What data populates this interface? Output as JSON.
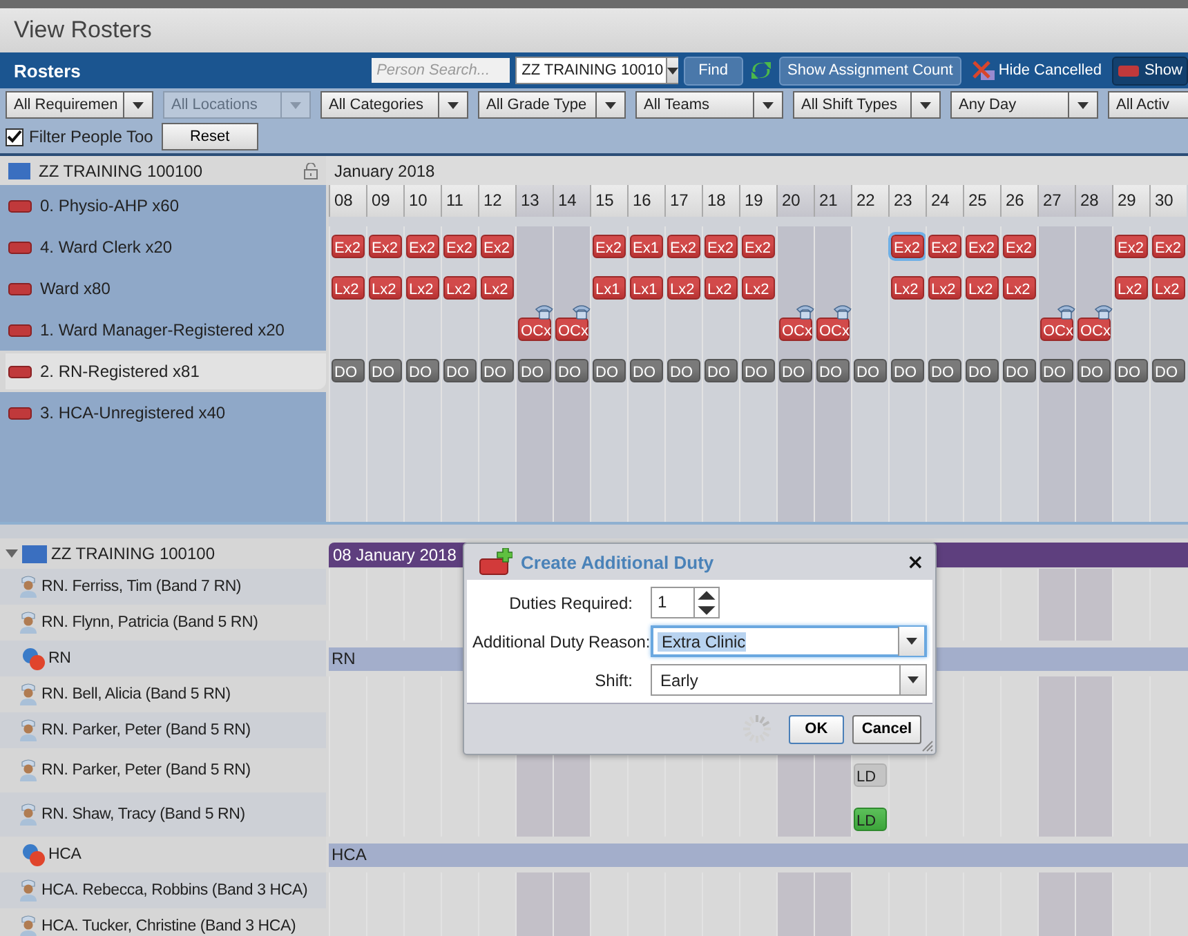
{
  "page_title": "View Rosters",
  "toolbar": {
    "title": "Rosters",
    "search": {
      "placeholder": "Person Search..."
    },
    "roster": {
      "value": "ZZ TRAINING 10010"
    },
    "find": "Find",
    "assignment_count": "Show Assignment Count",
    "hide_cancelled": {
      "label": "Hide Cancelled",
      "pressed": false
    },
    "show": {
      "label": "Show",
      "pressed": true
    }
  },
  "filters": [
    {
      "label": "All Requiremen",
      "disabled": false
    },
    {
      "label": "All Locations",
      "disabled": true
    },
    {
      "label": "All Categories",
      "disabled": false
    },
    {
      "label": "All Grade Type",
      "disabled": false
    },
    {
      "label": "All Teams",
      "disabled": false
    },
    {
      "label": "All Shift Types",
      "disabled": false
    },
    {
      "label": "Any Day",
      "disabled": false
    },
    {
      "label": "All Activ",
      "disabled": false
    }
  ],
  "filter_people_too": {
    "label": "Filter People Too",
    "checked": true
  },
  "reset": "Reset",
  "upper": {
    "roster": "ZZ TRAINING 100100",
    "month": "January 2018",
    "days": [
      {
        "label": "08",
        "weekend": false
      },
      {
        "label": "09",
        "weekend": false
      },
      {
        "label": "10",
        "weekend": false
      },
      {
        "label": "11",
        "weekend": false
      },
      {
        "label": "12",
        "weekend": false
      },
      {
        "label": "13",
        "weekend": true
      },
      {
        "label": "14",
        "weekend": true
      },
      {
        "label": "15",
        "weekend": false
      },
      {
        "label": "16",
        "weekend": false
      },
      {
        "label": "17",
        "weekend": false
      },
      {
        "label": "18",
        "weekend": false
      },
      {
        "label": "19",
        "weekend": false
      },
      {
        "label": "20",
        "weekend": true
      },
      {
        "label": "21",
        "weekend": true
      },
      {
        "label": "22",
        "weekend": false
      },
      {
        "label": "23",
        "weekend": false
      },
      {
        "label": "24",
        "weekend": false
      },
      {
        "label": "25",
        "weekend": false
      },
      {
        "label": "26",
        "weekend": false
      },
      {
        "label": "27",
        "weekend": true
      },
      {
        "label": "28",
        "weekend": true
      },
      {
        "label": "29",
        "weekend": false
      },
      {
        "label": "30",
        "weekend": false
      }
    ],
    "requirements": [
      {
        "label": "0. Physio-AHP x60",
        "selected": false
      },
      {
        "label": "4. Ward Clerk x20",
        "selected": false,
        "cells": [
          {
            "kind": "duty",
            "label": "Ex2",
            "selected": false
          },
          {
            "kind": "duty",
            "label": "Ex2",
            "selected": false
          },
          {
            "kind": "duty",
            "label": "Ex2",
            "selected": false
          },
          {
            "kind": "duty",
            "label": "Ex2",
            "selected": false
          },
          {
            "kind": "duty",
            "label": "Ex2",
            "selected": false
          },
          {
            "kind": "empty"
          },
          {
            "kind": "empty"
          },
          {
            "kind": "duty",
            "label": "Ex2",
            "selected": false
          },
          {
            "kind": "duty",
            "label": "Ex1",
            "selected": false
          },
          {
            "kind": "duty",
            "label": "Ex2",
            "selected": false
          },
          {
            "kind": "duty",
            "label": "Ex2",
            "selected": false
          },
          {
            "kind": "duty",
            "label": "Ex2",
            "selected": false
          },
          {
            "kind": "empty"
          },
          {
            "kind": "empty"
          },
          {
            "kind": "empty"
          },
          {
            "kind": "duty",
            "label": "Ex2",
            "selected": true
          },
          {
            "kind": "duty",
            "label": "Ex2",
            "selected": false
          },
          {
            "kind": "duty",
            "label": "Ex2",
            "selected": false
          },
          {
            "kind": "duty",
            "label": "Ex2",
            "selected": false
          },
          {
            "kind": "empty"
          },
          {
            "kind": "empty"
          },
          {
            "kind": "duty",
            "label": "Ex2",
            "selected": false
          },
          {
            "kind": "duty",
            "label": "Ex2",
            "selected": false
          }
        ]
      },
      {
        "label": "Ward  x80",
        "selected": false,
        "cells": [
          {
            "kind": "duty",
            "label": "Lx2",
            "selected": false
          },
          {
            "kind": "duty",
            "label": "Lx2",
            "selected": false
          },
          {
            "kind": "duty",
            "label": "Lx2",
            "selected": false
          },
          {
            "kind": "duty",
            "label": "Lx2",
            "selected": false
          },
          {
            "kind": "duty",
            "label": "Lx2",
            "selected": false
          },
          {
            "kind": "empty"
          },
          {
            "kind": "empty"
          },
          {
            "kind": "duty",
            "label": "Lx1",
            "selected": false
          },
          {
            "kind": "duty",
            "label": "Lx1",
            "selected": false
          },
          {
            "kind": "duty",
            "label": "Lx2",
            "selected": false
          },
          {
            "kind": "duty",
            "label": "Lx2",
            "selected": false
          },
          {
            "kind": "duty",
            "label": "Lx2",
            "selected": false
          },
          {
            "kind": "empty"
          },
          {
            "kind": "empty"
          },
          {
            "kind": "empty"
          },
          {
            "kind": "duty",
            "label": "Lx2",
            "selected": false
          },
          {
            "kind": "duty",
            "label": "Lx2",
            "selected": false
          },
          {
            "kind": "duty",
            "label": "Lx2",
            "selected": false
          },
          {
            "kind": "duty",
            "label": "Lx2",
            "selected": false
          },
          {
            "kind": "empty"
          },
          {
            "kind": "empty"
          },
          {
            "kind": "duty",
            "label": "Lx2",
            "selected": false
          },
          {
            "kind": "duty",
            "label": "Lx2",
            "selected": false
          }
        ]
      },
      {
        "label": "1. Ward Manager-Registered x20",
        "selected": false,
        "cells": [
          {
            "kind": "empty"
          },
          {
            "kind": "empty"
          },
          {
            "kind": "empty"
          },
          {
            "kind": "empty"
          },
          {
            "kind": "empty"
          },
          {
            "kind": "oncall",
            "label": "OCx",
            "selected": false
          },
          {
            "kind": "oncall",
            "label": "OCx",
            "selected": false
          },
          {
            "kind": "empty"
          },
          {
            "kind": "empty"
          },
          {
            "kind": "empty"
          },
          {
            "kind": "empty"
          },
          {
            "kind": "empty"
          },
          {
            "kind": "oncall",
            "label": "OCx",
            "selected": false
          },
          {
            "kind": "oncall",
            "label": "OCx",
            "selected": false
          },
          {
            "kind": "empty"
          },
          {
            "kind": "empty"
          },
          {
            "kind": "empty"
          },
          {
            "kind": "empty"
          },
          {
            "kind": "empty"
          },
          {
            "kind": "oncall",
            "label": "OCx",
            "selected": false
          },
          {
            "kind": "oncall",
            "label": "OCx",
            "selected": false
          },
          {
            "kind": "empty"
          },
          {
            "kind": "empty"
          }
        ]
      },
      {
        "label": "2. RN-Registered x81",
        "selected": true,
        "cells": [
          {
            "kind": "dayoff",
            "label": "DO",
            "selected": false
          },
          {
            "kind": "dayoff",
            "label": "DO",
            "selected": false
          },
          {
            "kind": "dayoff",
            "label": "DO",
            "selected": false
          },
          {
            "kind": "dayoff",
            "label": "DO",
            "selected": false
          },
          {
            "kind": "dayoff",
            "label": "DO",
            "selected": false
          },
          {
            "kind": "dayoff",
            "label": "DO",
            "selected": false
          },
          {
            "kind": "dayoff",
            "label": "DO",
            "selected": false
          },
          {
            "kind": "dayoff",
            "label": "DO",
            "selected": false
          },
          {
            "kind": "dayoff",
            "label": "DO",
            "selected": false
          },
          {
            "kind": "dayoff",
            "label": "DO",
            "selected": false
          },
          {
            "kind": "dayoff",
            "label": "DO",
            "selected": false
          },
          {
            "kind": "dayoff",
            "label": "DO",
            "selected": false
          },
          {
            "kind": "dayoff",
            "label": "DO",
            "selected": false
          },
          {
            "kind": "dayoff",
            "label": "DO",
            "selected": false
          },
          {
            "kind": "dayoff",
            "label": "DO",
            "selected": false
          },
          {
            "kind": "dayoff",
            "label": "DO",
            "selected": false
          },
          {
            "kind": "dayoff",
            "label": "DO",
            "selected": false
          },
          {
            "kind": "dayoff",
            "label": "DO",
            "selected": false
          },
          {
            "kind": "dayoff",
            "label": "DO",
            "selected": false
          },
          {
            "kind": "dayoff",
            "label": "DO",
            "selected": false
          },
          {
            "kind": "dayoff",
            "label": "DO",
            "selected": false
          },
          {
            "kind": "dayoff",
            "label": "DO",
            "selected": false
          },
          {
            "kind": "dayoff",
            "label": "DO",
            "selected": false
          }
        ]
      },
      {
        "label": "3. HCA-Unregistered x40",
        "selected": false
      }
    ]
  },
  "lower": {
    "group": {
      "label": "ZZ TRAINING 100100",
      "expanded": true
    },
    "date_bar": "08 January 2018",
    "rows": [
      {
        "kind": "person",
        "label": "RN. Ferriss, Tim (Band 7 RN)"
      },
      {
        "kind": "person",
        "label": "RN. Flynn, Patricia (Band 5 RN)"
      },
      {
        "kind": "group",
        "label": "RN",
        "band_label": "RN"
      },
      {
        "kind": "person",
        "label": "RN. Bell, Alicia (Band 5 RN)"
      },
      {
        "kind": "person",
        "label": "RN. Parker, Peter (Band 5 RN)"
      },
      {
        "kind": "person",
        "label": "RN. Parker, Peter (Band 5 RN)",
        "cells": [
          {
            "kind": "empty"
          },
          {
            "kind": "empty"
          },
          {
            "kind": "empty"
          },
          {
            "kind": "empty"
          },
          {
            "kind": "empty"
          },
          {
            "kind": "empty"
          },
          {
            "kind": "empty"
          },
          {
            "kind": "empty"
          },
          {
            "kind": "empty"
          },
          {
            "kind": "empty"
          },
          {
            "kind": "empty"
          },
          {
            "kind": "empty"
          },
          {
            "kind": "empty"
          },
          {
            "kind": "empty"
          },
          {
            "kind": "pending",
            "label": "LD",
            "selected": false
          }
        ]
      },
      {
        "kind": "person",
        "label": "RN. Shaw, Tracy (Band 5 RN)",
        "cells": [
          {
            "kind": "empty"
          },
          {
            "kind": "empty"
          },
          {
            "kind": "empty"
          },
          {
            "kind": "empty"
          },
          {
            "kind": "empty"
          },
          {
            "kind": "empty"
          },
          {
            "kind": "empty"
          },
          {
            "kind": "empty"
          },
          {
            "kind": "empty"
          },
          {
            "kind": "empty"
          },
          {
            "kind": "empty"
          },
          {
            "kind": "empty"
          },
          {
            "kind": "empty"
          },
          {
            "kind": "empty"
          },
          {
            "kind": "confirmed",
            "label": "LD",
            "selected": false
          }
        ]
      },
      {
        "kind": "group",
        "label": "HCA",
        "band_label": "HCA"
      },
      {
        "kind": "person",
        "label": "HCA. Rebecca, Robbins (Band 3 HCA)"
      },
      {
        "kind": "person",
        "label": "HCA. Tucker, Christine (Band 3 HCA)"
      }
    ]
  },
  "dialog": {
    "title": "Create Additional Duty",
    "close": "×",
    "fields": [
      {
        "kind": "spinner",
        "label": "Duties Required:",
        "value": "1",
        "focused": false
      },
      {
        "kind": "combo",
        "label": "Additional Duty Reason:",
        "value": "Extra Clinic",
        "focused": true
      },
      {
        "kind": "combo",
        "label": "Shift:",
        "value": "Early",
        "focused": false
      }
    ],
    "buttons": [
      "OK",
      "Cancel"
    ]
  }
}
